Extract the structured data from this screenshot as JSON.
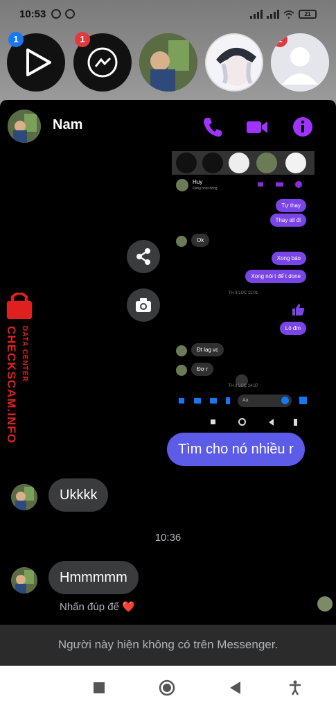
{
  "status_bar": {
    "time": "10:53",
    "battery": "21"
  },
  "chat_heads": [
    {
      "name": "play-head",
      "badge": "1"
    },
    {
      "name": "messenger-head",
      "badge": "1"
    },
    {
      "name": "user-head"
    },
    {
      "name": "anime-head"
    },
    {
      "name": "blank-head",
      "badge": "1"
    }
  ],
  "chat": {
    "contact_name": "Nam",
    "header_actions": [
      "phone-icon",
      "video-icon",
      "info-icon"
    ],
    "accent": "#8a2be2",
    "floating_actions": [
      "share-icon",
      "camera-icon"
    ],
    "shared_screenshot": {
      "contact": "Huy",
      "status": "Đang hoạt động",
      "messages": [
        {
          "side": "right",
          "text": "Tự thay"
        },
        {
          "side": "right",
          "text": "Thay all đi"
        },
        {
          "side": "left",
          "text": "Ok"
        },
        {
          "side": "right",
          "text": "Xong báo"
        },
        {
          "side": "right",
          "text": "Xong nói t để t done"
        },
        {
          "side": "time",
          "text": "TH 3 LÚC 11:01"
        },
        {
          "side": "right",
          "text": "Lô đm"
        },
        {
          "side": "left",
          "text": "Đt lag vc"
        },
        {
          "side": "left",
          "text": "Đơ r"
        },
        {
          "side": "time",
          "text": "TH 3 LÚC 14:37"
        }
      ],
      "composer_placeholder": "Aa"
    },
    "messages": [
      {
        "side": "right",
        "text": "Tìm cho nó nhiều r"
      },
      {
        "side": "left",
        "text": "Ukkkk"
      },
      {
        "side": "time",
        "text": "10:36"
      },
      {
        "side": "left",
        "text": "Hmmmmm"
      }
    ],
    "hint": "Nhấn đúp để ❤️",
    "notice": "Người này hiện không có trên Messenger."
  },
  "watermark": {
    "line1": "DATA CENTER",
    "line2": "CHECKSCAM.INFO"
  },
  "navbar": [
    "recents-button",
    "home-button",
    "back-button",
    "accessibility-button"
  ]
}
